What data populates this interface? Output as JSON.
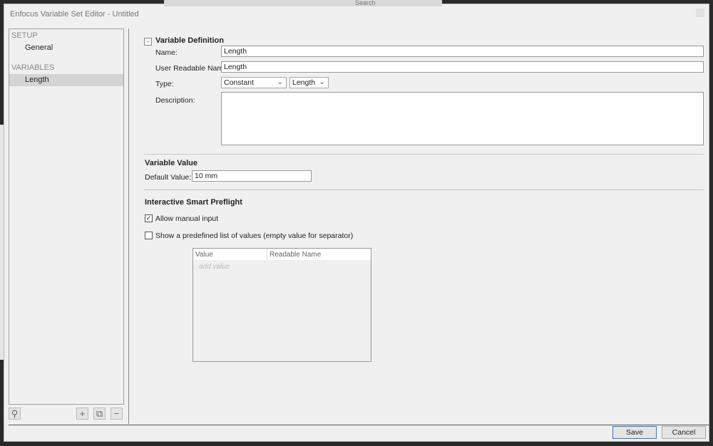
{
  "background": {
    "search_label": "Search"
  },
  "window": {
    "title": "Enfocus Variable Set Editor - Untitled"
  },
  "sidebar": {
    "sections": [
      {
        "label": "SETUP",
        "items": [
          {
            "label": "General",
            "selected": false
          }
        ]
      },
      {
        "label": "VARIABLES",
        "items": [
          {
            "label": "Length",
            "selected": true
          }
        ]
      }
    ],
    "toolbar": {
      "search_icon": "magnifier-icon",
      "add": "+",
      "duplicate_icon": "duplicate-icon",
      "remove": "−"
    }
  },
  "definition": {
    "title": "Variable Definition",
    "collapse": "−",
    "name_label": "Name:",
    "name": "Length",
    "readable_label": "User Readable Name:",
    "readable": "Length",
    "type_label": "Type:",
    "type": "Constant",
    "subtype": "Length",
    "description_label": "Description:",
    "description": ""
  },
  "value": {
    "title": "Variable Value",
    "default_label": "Default Value:",
    "default": "10 mm"
  },
  "preflight": {
    "title": "Interactive Smart Preflight",
    "allow_manual": {
      "label": "Allow manual input",
      "checked": true
    },
    "predefined": {
      "label": "Show a predefined list of values (empty value for separator)",
      "checked": false
    },
    "table": {
      "columns": [
        "Value",
        "Readable Name"
      ],
      "placeholder": "add value"
    }
  },
  "footer": {
    "save": "Save",
    "cancel": "Cancel"
  }
}
